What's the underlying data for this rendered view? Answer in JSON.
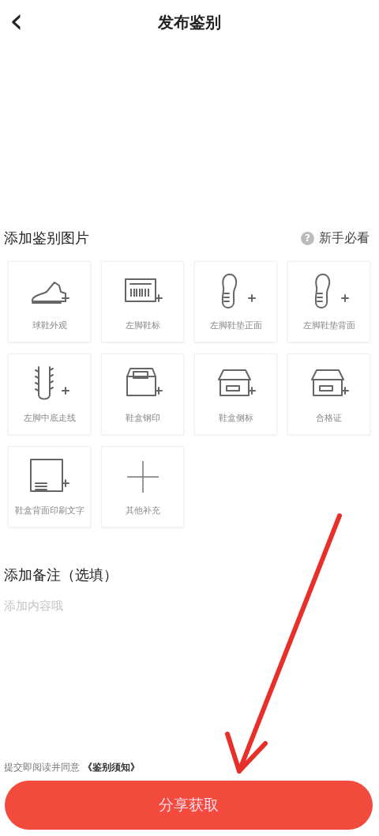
{
  "header": {
    "title": "发布鉴别",
    "back": "‹"
  },
  "photos": {
    "title": "添加鉴别图片",
    "help": "新手必看",
    "help_icon": "?",
    "items": [
      {
        "label": "球鞋外观"
      },
      {
        "label": "左脚鞋标"
      },
      {
        "label": "左脚鞋垫正面"
      },
      {
        "label": "左脚鞋垫背面"
      },
      {
        "label": "左脚中底走线"
      },
      {
        "label": "鞋盒钢印"
      },
      {
        "label": "鞋盒侧标"
      },
      {
        "label": "合格证"
      },
      {
        "label": "鞋盒背面印刷文字"
      },
      {
        "label": "其他补充"
      }
    ]
  },
  "note": {
    "title": "添加备注（选填）",
    "placeholder": "添加内容哦"
  },
  "agreement": {
    "text": "提交即阅读并同意",
    "link": "《鉴别须知》"
  },
  "submit": {
    "label": "分享获取"
  },
  "annotations": [
    {
      "kind": "arrow"
    }
  ]
}
